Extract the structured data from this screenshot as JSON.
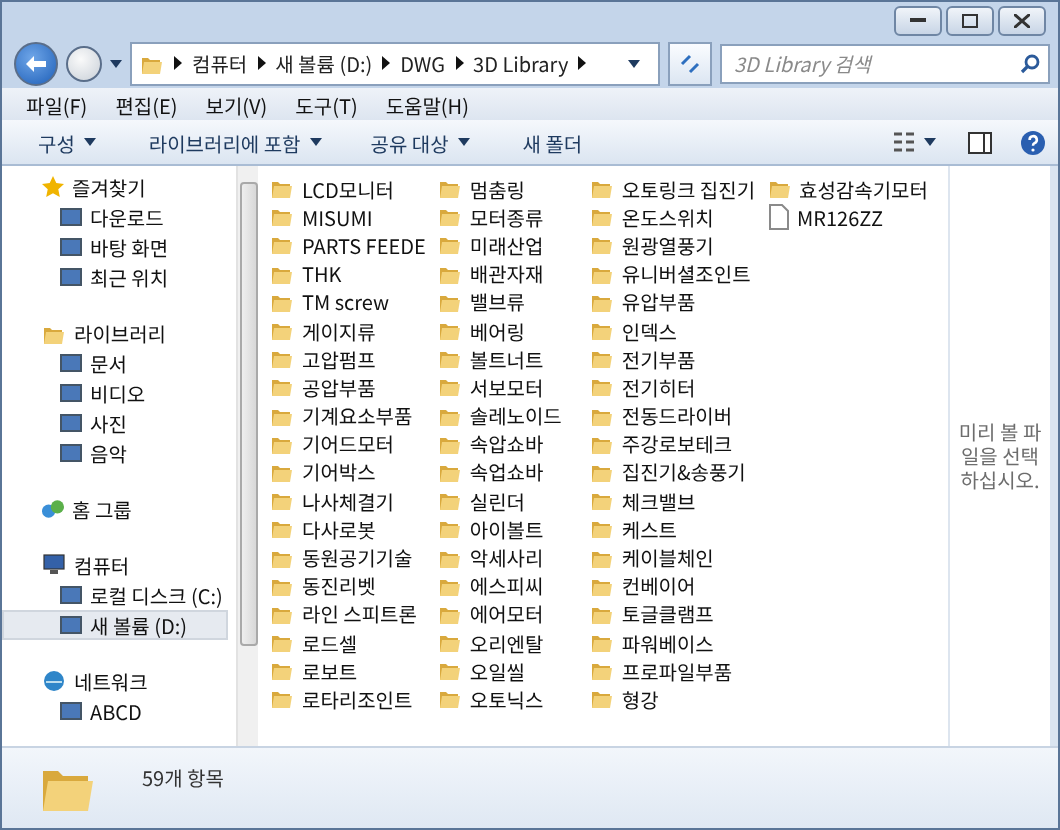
{
  "address": {
    "crumbs": [
      "컴퓨터",
      "새 볼륨 (D:)",
      "DWG",
      "3D Library"
    ]
  },
  "search": {
    "placeholder": "3D Library 검색"
  },
  "menu": [
    "파일(F)",
    "편집(E)",
    "보기(V)",
    "도구(T)",
    "도움말(H)"
  ],
  "toolbar": [
    {
      "label": "구성",
      "dropdown": true
    },
    {
      "label": "라이브러리에 포함",
      "dropdown": true
    },
    {
      "label": "공유 대상",
      "dropdown": true
    },
    {
      "label": "새 폴더",
      "dropdown": false
    }
  ],
  "nav": [
    {
      "label": "즐겨찾기",
      "selected": false,
      "children": [
        {
          "label": "다운로드",
          "selected": false
        },
        {
          "label": "바탕 화면",
          "selected": false
        },
        {
          "label": "최근 위치",
          "selected": false
        }
      ]
    },
    {
      "label": "라이브러리",
      "selected": false,
      "children": [
        {
          "label": "문서",
          "selected": false
        },
        {
          "label": "비디오",
          "selected": false
        },
        {
          "label": "사진",
          "selected": false
        },
        {
          "label": "음악",
          "selected": false
        }
      ]
    },
    {
      "label": "홈 그룹",
      "selected": false
    },
    {
      "label": "컴퓨터",
      "selected": false,
      "children": [
        {
          "label": "로컬 디스크 (C:)",
          "selected": false
        },
        {
          "label": "새 볼륨 (D:)",
          "selected": true
        }
      ]
    },
    {
      "label": "네트워크",
      "selected": false,
      "children": [
        {
          "label": "ABCD",
          "selected": false
        }
      ]
    }
  ],
  "files": [
    {
      "name": "LCD모니터",
      "kind": "folder"
    },
    {
      "name": "MISUMI",
      "kind": "folder"
    },
    {
      "name": "PARTS FEEDE",
      "kind": "folder"
    },
    {
      "name": "THK",
      "kind": "folder"
    },
    {
      "name": "TM screw",
      "kind": "folder"
    },
    {
      "name": "게이지류",
      "kind": "folder"
    },
    {
      "name": "고압펌프",
      "kind": "folder"
    },
    {
      "name": "공압부품",
      "kind": "folder"
    },
    {
      "name": "기계요소부품",
      "kind": "folder"
    },
    {
      "name": "기어드모터",
      "kind": "folder"
    },
    {
      "name": "기어박스",
      "kind": "folder"
    },
    {
      "name": "나사체결기",
      "kind": "folder"
    },
    {
      "name": "다사로봇",
      "kind": "folder"
    },
    {
      "name": "동원공기기술",
      "kind": "folder"
    },
    {
      "name": "동진리벳",
      "kind": "folder"
    },
    {
      "name": "라인 스피트론",
      "kind": "folder"
    },
    {
      "name": "로드셀",
      "kind": "folder"
    },
    {
      "name": "로보트",
      "kind": "folder"
    },
    {
      "name": "로타리조인트",
      "kind": "folder"
    },
    {
      "name": "멈춤링",
      "kind": "folder"
    },
    {
      "name": "모터종류",
      "kind": "folder"
    },
    {
      "name": "미래산업",
      "kind": "folder"
    },
    {
      "name": "배관자재",
      "kind": "folder"
    },
    {
      "name": "밸브류",
      "kind": "folder"
    },
    {
      "name": "베어링",
      "kind": "folder"
    },
    {
      "name": "볼트너트",
      "kind": "folder"
    },
    {
      "name": "서보모터",
      "kind": "folder"
    },
    {
      "name": "솔레노이드",
      "kind": "folder"
    },
    {
      "name": "속압쇼바",
      "kind": "folder"
    },
    {
      "name": "속업쇼바",
      "kind": "folder"
    },
    {
      "name": "실린더",
      "kind": "folder"
    },
    {
      "name": "아이볼트",
      "kind": "folder"
    },
    {
      "name": "악세사리",
      "kind": "folder"
    },
    {
      "name": "에스피씨",
      "kind": "folder"
    },
    {
      "name": "에어모터",
      "kind": "folder"
    },
    {
      "name": "오리엔탈",
      "kind": "folder"
    },
    {
      "name": "오일씰",
      "kind": "folder"
    },
    {
      "name": "오토닉스",
      "kind": "folder"
    },
    {
      "name": "오토링크 집진기",
      "kind": "folder"
    },
    {
      "name": "온도스위치",
      "kind": "folder"
    },
    {
      "name": "원광열풍기",
      "kind": "folder"
    },
    {
      "name": "유니버셜조인트",
      "kind": "folder"
    },
    {
      "name": "유압부품",
      "kind": "folder"
    },
    {
      "name": "인덱스",
      "kind": "folder"
    },
    {
      "name": "전기부품",
      "kind": "folder"
    },
    {
      "name": "전기히터",
      "kind": "folder"
    },
    {
      "name": "전동드라이버",
      "kind": "folder"
    },
    {
      "name": "주강로보테크",
      "kind": "folder"
    },
    {
      "name": "집진기&송풍기",
      "kind": "folder"
    },
    {
      "name": "체크밸브",
      "kind": "folder"
    },
    {
      "name": "케스트",
      "kind": "folder"
    },
    {
      "name": "케이블체인",
      "kind": "folder"
    },
    {
      "name": "컨베이어",
      "kind": "folder"
    },
    {
      "name": "토글클램프",
      "kind": "folder"
    },
    {
      "name": "파워베이스",
      "kind": "folder"
    },
    {
      "name": "프로파일부품",
      "kind": "folder"
    },
    {
      "name": "형강",
      "kind": "folder"
    },
    {
      "name": "효성감속기모터",
      "kind": "folder"
    },
    {
      "name": "MR126ZZ",
      "kind": "file"
    }
  ],
  "preview": {
    "message": "미리 볼 파일을 선택하십시오."
  },
  "status": {
    "count": "59개 항목"
  }
}
